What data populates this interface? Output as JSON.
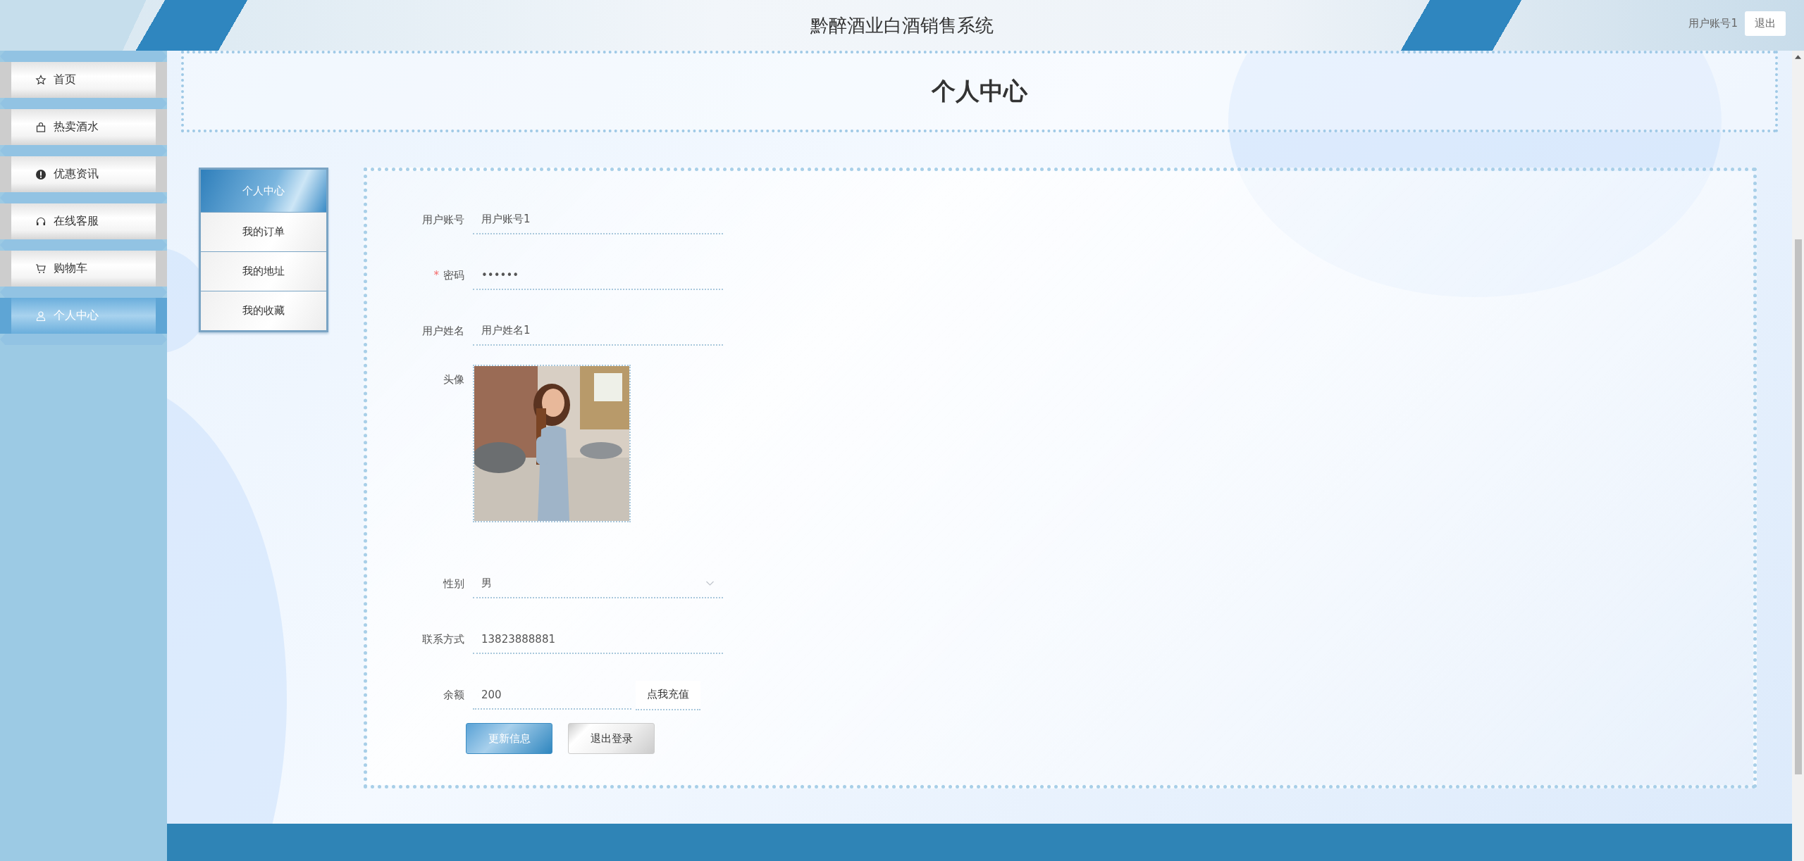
{
  "header": {
    "title": "黔醉酒业白酒销售系统",
    "user": "用户账号1",
    "logout": "退出"
  },
  "sidebar": {
    "items": [
      {
        "label": "首页",
        "kind": "star",
        "selected": false
      },
      {
        "label": "热卖酒水",
        "kind": "bag",
        "selected": false
      },
      {
        "label": "优惠资讯",
        "kind": "alert",
        "selected": false
      },
      {
        "label": "在线客服",
        "kind": "headset",
        "selected": false
      },
      {
        "label": "购物车",
        "kind": "cart",
        "selected": false
      },
      {
        "label": "个人中心",
        "kind": "user",
        "selected": true
      }
    ]
  },
  "page_title": "个人中心",
  "profile_menu": [
    {
      "label": "个人中心",
      "selected": true
    },
    {
      "label": "我的订单",
      "selected": false
    },
    {
      "label": "我的地址",
      "selected": false
    },
    {
      "label": "我的收藏",
      "selected": false
    }
  ],
  "form": {
    "fields": [
      {
        "kind": "text",
        "label": "用户账号",
        "value": "用户账号1"
      },
      {
        "kind": "text",
        "label": "密码",
        "value": "••••••",
        "required_mark": "*"
      },
      {
        "kind": "text",
        "label": "用户姓名",
        "value": "用户姓名1"
      },
      {
        "label": "头像"
      },
      {
        "kind": "select",
        "label": "性别",
        "value": "男"
      },
      {
        "kind": "text",
        "label": "联系方式",
        "value": "13823888881"
      },
      {
        "kind": "recharge",
        "label": "余额",
        "value": "200",
        "button": "点我充值"
      }
    ],
    "buttons": [
      {
        "label": "更新信息",
        "kind": "primary"
      },
      {
        "label": "退出登录",
        "kind": "secondary"
      }
    ]
  }
}
